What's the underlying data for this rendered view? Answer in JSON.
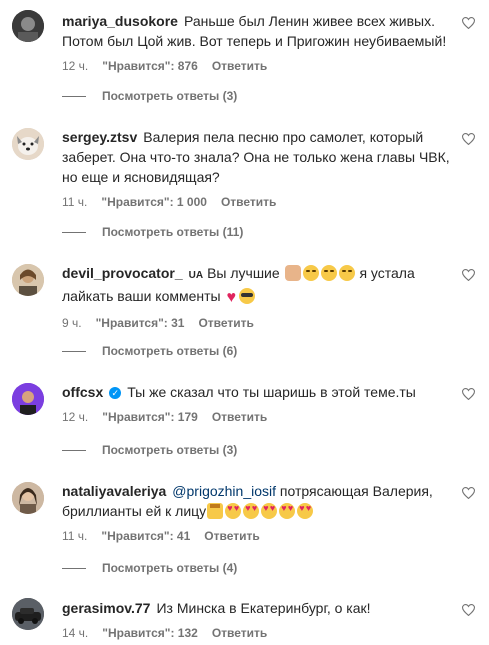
{
  "comments": [
    {
      "username": "mariya_dusokore",
      "text": "Раньше был Ленин живее всех живых. Потом был Цой жив. Вот теперь и Пригожин неубиваемый!",
      "time": "12 ч.",
      "likes": "\"Нравится\": 876",
      "reply_label": "Ответить",
      "view_replies": "Посмотреть ответы (3)"
    },
    {
      "username": "sergey.ztsv",
      "text": "Валерия пела песню про самолет, который заберет. Она что-то знала? Она не только жена главы ЧВК, но еще и ясновидящая?",
      "time": "11 ч.",
      "likes": "\"Нравится\": 1 000",
      "reply_label": "Ответить",
      "view_replies": "Посмотреть ответы (11)"
    },
    {
      "username": "devil_provocator_",
      "flag": "UA",
      "text_part1": "Вы лучшие",
      "text_part2": "я устала лайкать ваши комменты",
      "emoji_names": [
        "clap-emoji",
        "laughing-tears-emoji",
        "laughing-tears-emoji",
        "laughing-tears-emoji",
        "red-heart-emoji",
        "sunglasses-emoji"
      ],
      "time": "9 ч.",
      "likes": "\"Нравится\": 31",
      "reply_label": "Ответить",
      "view_replies": "Посмотреть ответы (6)"
    },
    {
      "username": "offcsx",
      "verified": true,
      "text": "Ты же сказал что ты шаришь в этой теме.ты",
      "time": "12 ч.",
      "likes": "\"Нравится\": 179",
      "reply_label": "Ответить",
      "view_replies": "Посмотреть ответы (3)"
    },
    {
      "username": "nataliyavaleriya",
      "mention": "@prigozhin_iosif",
      "text": "потрясающая Валерия, бриллианты ей к лицу",
      "emoji_names": [
        "princess-emoji",
        "heart-eyes-emoji",
        "heart-eyes-emoji",
        "heart-eyes-emoji",
        "heart-eyes-emoji",
        "heart-eyes-emoji"
      ],
      "time": "11 ч.",
      "likes": "\"Нравится\": 41",
      "reply_label": "Ответить",
      "view_replies": "Посмотреть ответы (4)"
    },
    {
      "username": "gerasimov.77",
      "text": "Из Минска в Екатеринбург, о как!",
      "time": "14 ч.",
      "likes": "\"Нравится\": 132",
      "reply_label": "Ответить"
    }
  ],
  "colors": {
    "text": "#262626",
    "secondary": "#737373",
    "mention": "#00376b",
    "verified": "#0095f6"
  }
}
